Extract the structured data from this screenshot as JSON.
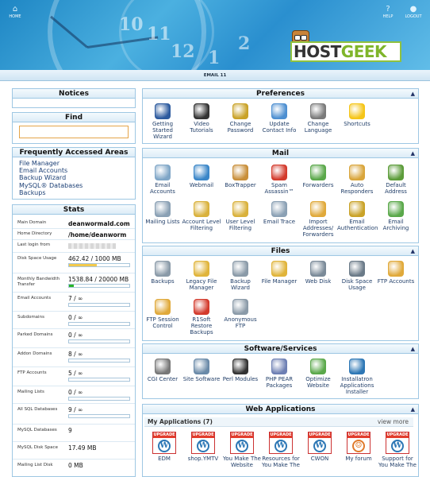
{
  "topbar": {
    "home": "HOME",
    "help": "HELP",
    "logout": "LOGOUT"
  },
  "brand": {
    "part1": "HOST",
    "part2": "GEEK"
  },
  "user_bar": "EMAIL 11",
  "header_numbers": [
    "10",
    "11",
    "12",
    "1",
    "2"
  ],
  "notices": {
    "title": "Notices"
  },
  "find": {
    "title": "Find",
    "value": ""
  },
  "faa": {
    "title": "Frequently Accessed Areas",
    "links": [
      "File Manager",
      "Email Accounts",
      "Backup Wizard",
      "MySQL® Databases",
      "Backups"
    ]
  },
  "stats": {
    "title": "Stats",
    "rows": [
      {
        "label": "Main Domain",
        "value": "deanwormald.com"
      },
      {
        "label": "Home Directory",
        "value": "/home/deanworm"
      },
      {
        "label": "Last login from",
        "value": ""
      },
      {
        "label": "Disk Space Usage",
        "value": "462.42 / 1000 MB",
        "fraction": 0.46,
        "color": "#f2c94c"
      },
      {
        "label": "Monthly Bandwidth Transfer",
        "value": "1538.84 / 20000 MB",
        "fraction": 0.08,
        "color": "#28b328"
      },
      {
        "label": "Email Accounts",
        "value": "7 / ∞",
        "fraction": 0
      },
      {
        "label": "Subdomains",
        "value": "0 / ∞",
        "fraction": 0
      },
      {
        "label": "Parked Domains",
        "value": "0 / ∞",
        "fraction": 0
      },
      {
        "label": "Addon Domains",
        "value": "8 / ∞",
        "fraction": 0
      },
      {
        "label": "FTP Accounts",
        "value": "5 / ∞",
        "fraction": 0
      },
      {
        "label": "Mailing Lists",
        "value": "0 / ∞",
        "fraction": 0
      },
      {
        "label": "All SQL Databases",
        "value": "9 / ∞",
        "fraction": 0
      },
      {
        "label": "MySQL Databases",
        "value": "9"
      },
      {
        "label": "MySQL Disk Space",
        "value": "17.49 MB"
      },
      {
        "label": "Mailing List Disk",
        "value": "0 MB"
      }
    ]
  },
  "preferences": {
    "title": "Preferences",
    "items": [
      {
        "label": "Getting Started Wizard",
        "icon": "play-icon",
        "color": "#2c5a9e"
      },
      {
        "label": "Video Tutorials",
        "icon": "clapper-icon",
        "color": "#333333"
      },
      {
        "label": "Change Password",
        "icon": "lock-icon",
        "color": "#c9a227"
      },
      {
        "label": "Update Contact Info",
        "icon": "contact-card-icon",
        "color": "#4d8fd1"
      },
      {
        "label": "Change Language",
        "icon": "language-icon",
        "color": "#7a7a7a"
      },
      {
        "label": "Shortcuts",
        "icon": "star-icon",
        "color": "#f5c518"
      }
    ]
  },
  "mail": {
    "title": "Mail",
    "items": [
      {
        "label": "Email Accounts",
        "icon": "envelope-icon",
        "color": "#7fa6c7"
      },
      {
        "label": "Webmail",
        "icon": "globe-mail-icon",
        "color": "#3a86c8"
      },
      {
        "label": "BoxTrapper",
        "icon": "box-trap-icon",
        "color": "#c98f3a"
      },
      {
        "label": "Spam Assassin™",
        "icon": "spam-assassin-icon",
        "color": "#d33a2c"
      },
      {
        "label": "Forwarders",
        "icon": "forward-icon",
        "color": "#5aa84a"
      },
      {
        "label": "Auto Responders",
        "icon": "autoresponder-icon",
        "color": "#d9a53b"
      },
      {
        "label": "Default Address",
        "icon": "default-address-icon",
        "color": "#5c9c3a"
      },
      {
        "label": "Mailing Lists",
        "icon": "mailing-list-icon",
        "color": "#8aa0b4"
      },
      {
        "label": "Account Level Filtering",
        "icon": "filter-icon",
        "color": "#d9b13b"
      },
      {
        "label": "User Level Filtering",
        "icon": "user-filter-icon",
        "color": "#d9b13b"
      },
      {
        "label": "Email Trace",
        "icon": "trace-icon",
        "color": "#8aa0b4"
      },
      {
        "label": "Import Addresses/ Forwarders",
        "icon": "import-icon",
        "color": "#e0a93a"
      },
      {
        "label": "Email Authentication",
        "icon": "auth-key-icon",
        "color": "#c9a227"
      },
      {
        "label": "Email Archiving",
        "icon": "archive-icon",
        "color": "#5aa84a"
      }
    ]
  },
  "files": {
    "title": "Files",
    "items": [
      {
        "label": "Backups",
        "icon": "backup-drive-icon",
        "color": "#8a9aa8"
      },
      {
        "label": "Legacy File Manager",
        "icon": "folder-icon",
        "color": "#e0b43a"
      },
      {
        "label": "Backup Wizard",
        "icon": "backup-wizard-icon",
        "color": "#8a9aa8"
      },
      {
        "label": "File Manager",
        "icon": "folder-open-icon",
        "color": "#e0b43a"
      },
      {
        "label": "Web Disk",
        "icon": "web-disk-icon",
        "color": "#7a8a98"
      },
      {
        "label": "Disk Space Usage",
        "icon": "disk-usage-icon",
        "color": "#6a7a88"
      },
      {
        "label": "FTP Accounts",
        "icon": "ftp-icon",
        "color": "#e0a93a"
      },
      {
        "label": "FTP Session Control",
        "icon": "ftp-session-icon",
        "color": "#e0a93a"
      },
      {
        "label": "R1Soft Restore Backups",
        "icon": "r1soft-icon",
        "color": "#d33a2c"
      },
      {
        "label": "Anonymous FTP",
        "icon": "anonymous-ftp-icon",
        "color": "#8a9aa8"
      }
    ]
  },
  "software": {
    "title": "Software/Services",
    "items": [
      {
        "label": "CGI Center",
        "icon": "cgi-icon",
        "color": "#777777"
      },
      {
        "label": "Site Software",
        "icon": "site-software-icon",
        "color": "#6a8aa8"
      },
      {
        "label": "Perl Modules",
        "icon": "perl-camel-icon",
        "color": "#333333"
      },
      {
        "label": "PHP PEAR Packages",
        "icon": "php-icon",
        "color": "#6d7fb3"
      },
      {
        "label": "Optimize Website",
        "icon": "optimize-icon",
        "color": "#5aa84a"
      },
      {
        "label": "Installatron Applications Installer",
        "icon": "installatron-icon",
        "color": "#2d77b5"
      }
    ]
  },
  "webapps": {
    "title": "Web Applications",
    "my_apps": "My Applications (7)",
    "view_more": "view more",
    "badge": "UPGRADE",
    "items": [
      {
        "label": "EDM",
        "icon": "wordpress-icon"
      },
      {
        "label": "shop.YMTV",
        "icon": "wordpress-icon"
      },
      {
        "label": "You Make The Website",
        "icon": "wordpress-icon"
      },
      {
        "label": "Resources for You Make The",
        "icon": "wordpress-icon"
      },
      {
        "label": "CWON",
        "icon": "wordpress-icon"
      },
      {
        "label": "My forum",
        "icon": "forum-icon"
      },
      {
        "label": "Support for You Make The",
        "icon": "wordpress-icon"
      }
    ]
  }
}
